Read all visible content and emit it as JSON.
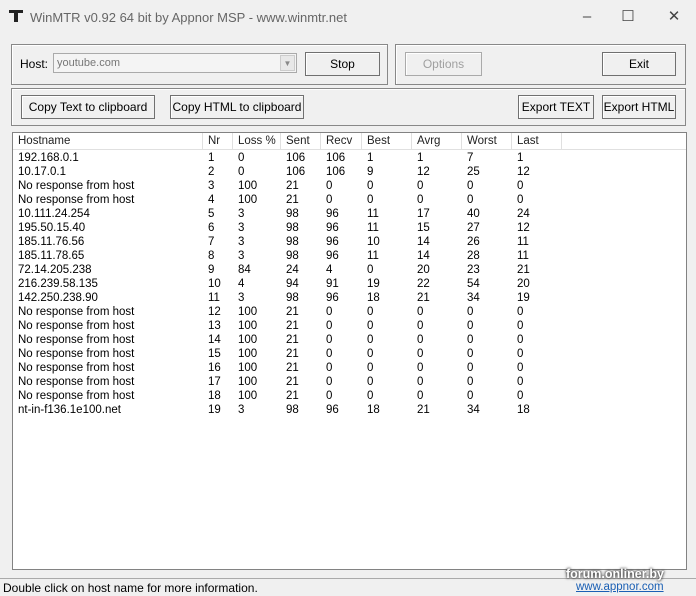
{
  "window": {
    "title": "WinMTR v0.92 64 bit by Appnor MSP - www.winmtr.net",
    "minimize": "–",
    "maximize": "☐",
    "close": "✕"
  },
  "host": {
    "label": "Host:",
    "value": "youtube.com",
    "arrow": "▼"
  },
  "buttons": {
    "stop": "Stop",
    "options": "Options",
    "exit": "Exit",
    "copy_text": "Copy Text to clipboard",
    "copy_html": "Copy HTML to clipboard",
    "export_text": "Export TEXT",
    "export_html": "Export HTML"
  },
  "table": {
    "columns": [
      "Hostname",
      "Nr",
      "Loss %",
      "Sent",
      "Recv",
      "Best",
      "Avrg",
      "Worst",
      "Last"
    ],
    "rows": [
      [
        "192.168.0.1",
        "1",
        "0",
        "106",
        "106",
        "1",
        "1",
        "7",
        "1"
      ],
      [
        "10.17.0.1",
        "2",
        "0",
        "106",
        "106",
        "9",
        "12",
        "25",
        "12"
      ],
      [
        "No response from host",
        "3",
        "100",
        "21",
        "0",
        "0",
        "0",
        "0",
        "0"
      ],
      [
        "No response from host",
        "4",
        "100",
        "21",
        "0",
        "0",
        "0",
        "0",
        "0"
      ],
      [
        "10.111.24.254",
        "5",
        "3",
        "98",
        "96",
        "11",
        "17",
        "40",
        "24"
      ],
      [
        "195.50.15.40",
        "6",
        "3",
        "98",
        "96",
        "11",
        "15",
        "27",
        "12"
      ],
      [
        "185.11.76.56",
        "7",
        "3",
        "98",
        "96",
        "10",
        "14",
        "26",
        "11"
      ],
      [
        "185.11.78.65",
        "8",
        "3",
        "98",
        "96",
        "11",
        "14",
        "28",
        "11"
      ],
      [
        "72.14.205.238",
        "9",
        "84",
        "24",
        "4",
        "0",
        "20",
        "23",
        "21"
      ],
      [
        "216.239.58.135",
        "10",
        "4",
        "94",
        "91",
        "19",
        "22",
        "54",
        "20"
      ],
      [
        "142.250.238.90",
        "11",
        "3",
        "98",
        "96",
        "18",
        "21",
        "34",
        "19"
      ],
      [
        "No response from host",
        "12",
        "100",
        "21",
        "0",
        "0",
        "0",
        "0",
        "0"
      ],
      [
        "No response from host",
        "13",
        "100",
        "21",
        "0",
        "0",
        "0",
        "0",
        "0"
      ],
      [
        "No response from host",
        "14",
        "100",
        "21",
        "0",
        "0",
        "0",
        "0",
        "0"
      ],
      [
        "No response from host",
        "15",
        "100",
        "21",
        "0",
        "0",
        "0",
        "0",
        "0"
      ],
      [
        "No response from host",
        "16",
        "100",
        "21",
        "0",
        "0",
        "0",
        "0",
        "0"
      ],
      [
        "No response from host",
        "17",
        "100",
        "21",
        "0",
        "0",
        "0",
        "0",
        "0"
      ],
      [
        "No response from host",
        "18",
        "100",
        "21",
        "0",
        "0",
        "0",
        "0",
        "0"
      ],
      [
        "nt-in-f136.1e100.net",
        "19",
        "3",
        "98",
        "96",
        "18",
        "21",
        "34",
        "18"
      ]
    ]
  },
  "status": {
    "text": "Double click on host name for more information.",
    "link": "www.appnor.com"
  },
  "watermark": "forum.onliner.by"
}
